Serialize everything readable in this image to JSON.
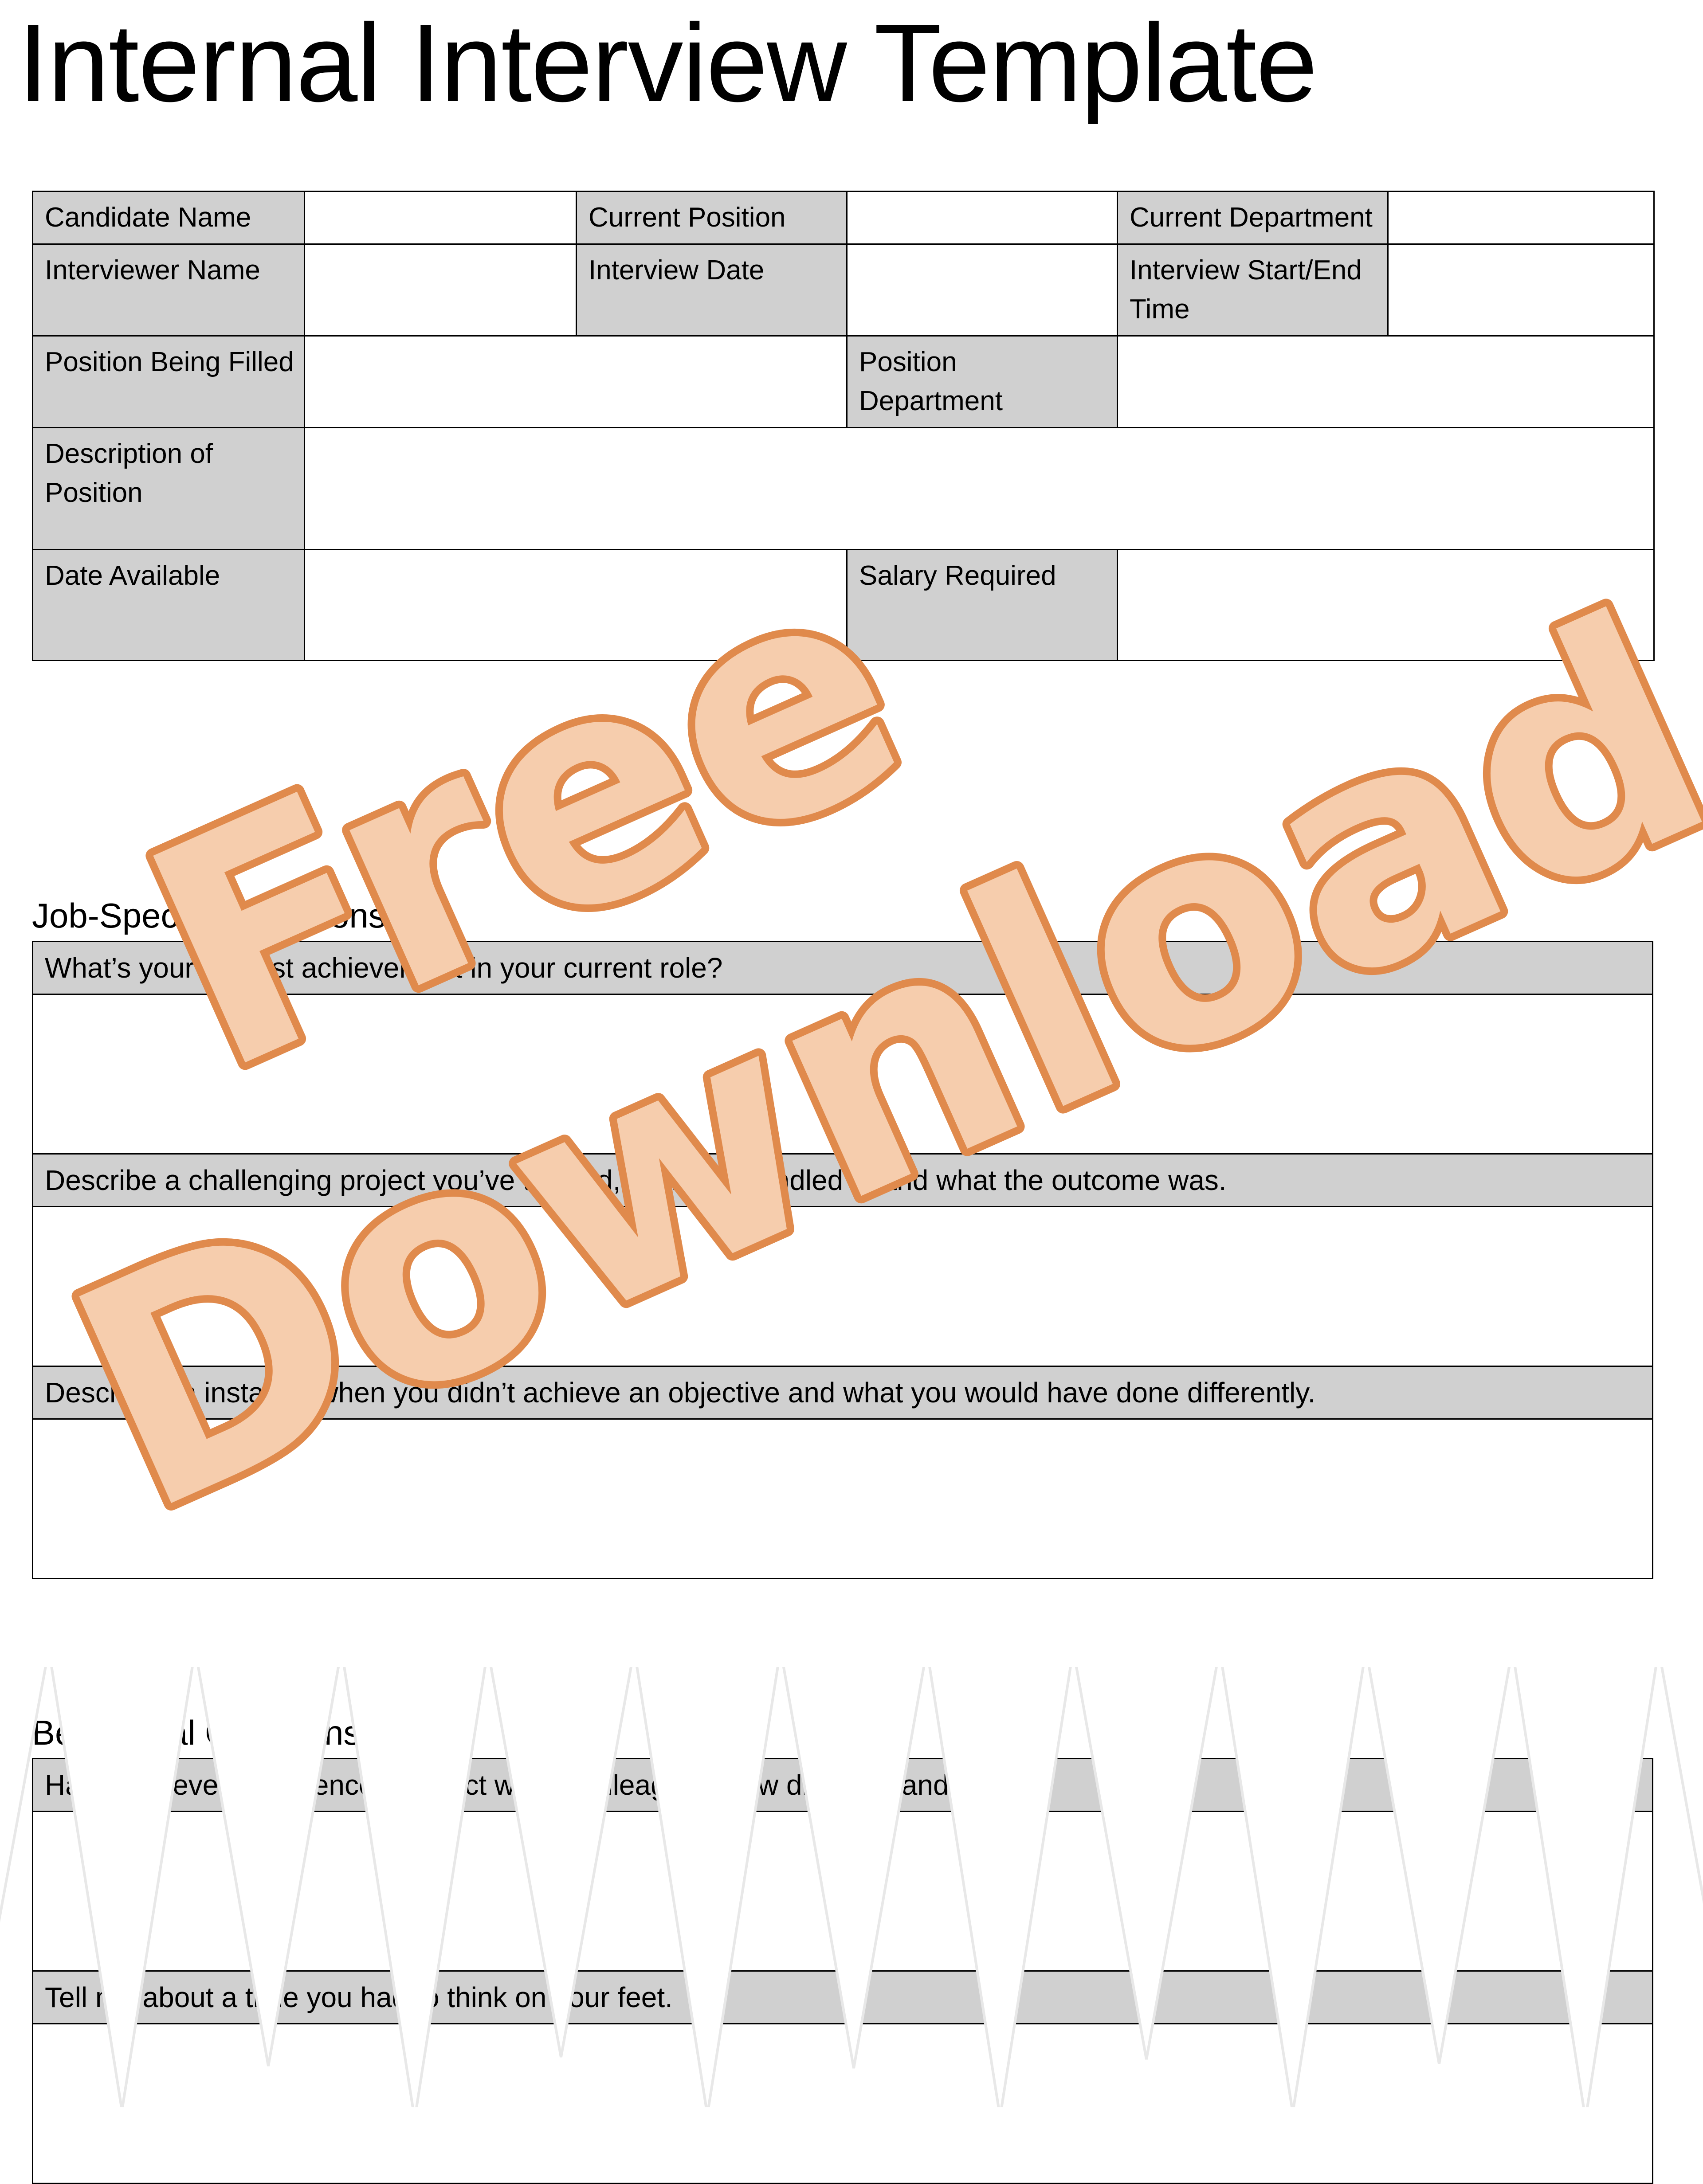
{
  "document": {
    "title": "Internal Interview Template"
  },
  "info_table": {
    "rows": [
      {
        "cells": [
          {
            "type": "label",
            "text": "Candidate Name"
          },
          {
            "type": "blank",
            "text": ""
          },
          {
            "type": "label",
            "text": "Current Position"
          },
          {
            "type": "blank",
            "text": ""
          },
          {
            "type": "label",
            "text": "Current Department"
          },
          {
            "type": "blank",
            "text": ""
          }
        ]
      },
      {
        "cells": [
          {
            "type": "label",
            "text": "Interviewer Name"
          },
          {
            "type": "blank",
            "text": ""
          },
          {
            "type": "label",
            "text": "Interview Date"
          },
          {
            "type": "blank",
            "text": ""
          },
          {
            "type": "label",
            "text": "Interview Start/End Time"
          },
          {
            "type": "blank",
            "text": ""
          }
        ]
      },
      {
        "cells": [
          {
            "type": "label",
            "text": "Position Being Filled"
          },
          {
            "type": "blank",
            "text": ""
          },
          {
            "type": "label",
            "text": "Position Department"
          },
          {
            "type": "blank",
            "text": ""
          }
        ]
      },
      {
        "cells": [
          {
            "type": "label",
            "text": "Description of Position"
          },
          {
            "type": "blank",
            "text": ""
          }
        ]
      },
      {
        "cells": [
          {
            "type": "label",
            "text": "Date Available"
          },
          {
            "type": "blank",
            "text": ""
          },
          {
            "type": "label",
            "text": "Salary Required"
          },
          {
            "type": "blank",
            "text": ""
          }
        ]
      }
    ]
  },
  "sections": {
    "job_specific": {
      "heading": "Job-Specific Questions",
      "questions": [
        "What’s your biggest achievement in your current role?",
        "Describe a challenging project you’ve tackled, how you handled it, and what the outcome was.",
        "Describe an instance when you didn’t achieve an objective and what you would have done differently."
      ],
      "answer_placeholder": ""
    },
    "behavioral": {
      "heading": "Behavioral Questions",
      "questions": [
        "Have you ever experienced conflict with a colleague? How did you handle it?",
        "Tell me about a time you had to think on your feet."
      ],
      "answer_placeholder": ""
    }
  },
  "watermark": {
    "line1": "Free",
    "line2": "Download",
    "fill_color": "#f6cdad",
    "outline_color": "#e08a4c"
  },
  "colors": {
    "label_cell_background": "#d0d0d0",
    "border": "#000000",
    "page_background": "#ffffff"
  }
}
